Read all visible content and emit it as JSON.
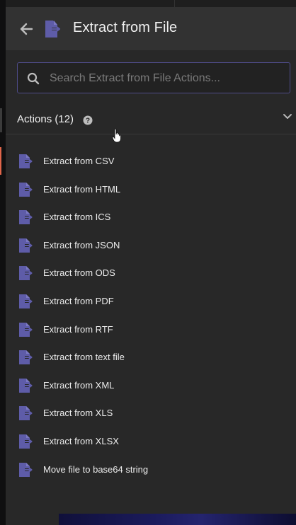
{
  "header": {
    "title": "Extract from File"
  },
  "search": {
    "placeholder": "Search Extract from File Actions..."
  },
  "section": {
    "title": "Actions (12)"
  },
  "actions": [
    {
      "label": "Extract from CSV"
    },
    {
      "label": "Extract from HTML"
    },
    {
      "label": "Extract from ICS"
    },
    {
      "label": "Extract from JSON"
    },
    {
      "label": "Extract from ODS"
    },
    {
      "label": "Extract from PDF"
    },
    {
      "label": "Extract from RTF"
    },
    {
      "label": "Extract from text file"
    },
    {
      "label": "Extract from XML"
    },
    {
      "label": "Extract from XLS"
    },
    {
      "label": "Extract from XLSX"
    },
    {
      "label": "Move file to base64 string"
    }
  ],
  "colors": {
    "accent": "#e0654a",
    "icon": "#5e5ca8",
    "search_border": "#4f4c8a"
  }
}
